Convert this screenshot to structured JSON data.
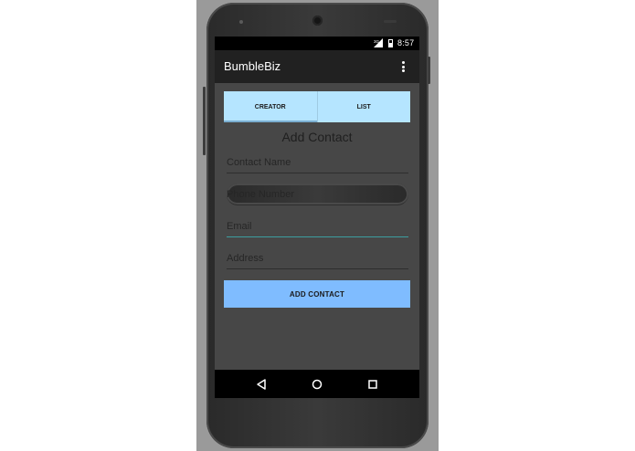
{
  "status_bar": {
    "signal_label": "3G",
    "time": "8:57"
  },
  "app_bar": {
    "title": "BumbleBiz",
    "overflow_icon": "more-vert-icon"
  },
  "tabs": [
    {
      "label": "CREATOR",
      "active": true
    },
    {
      "label": "LIST",
      "active": false
    }
  ],
  "form": {
    "title": "Add Contact",
    "fields": {
      "name": {
        "placeholder": "Contact Name",
        "value": ""
      },
      "phone": {
        "placeholder": "Phone Number",
        "value": ""
      },
      "email": {
        "placeholder": "Email",
        "value": ""
      },
      "address": {
        "placeholder": "Address",
        "value": ""
      }
    },
    "submit_label": "ADD CONTACT"
  },
  "nav_bar": {
    "back_icon": "back-triangle-icon",
    "home_icon": "home-circle-icon",
    "recent_icon": "recents-square-icon"
  },
  "colors": {
    "tab_bg": "#b5e5ff",
    "button_bg": "#7fbcff",
    "app_bar": "#212121",
    "screen_bg": "#474747",
    "focus_accent": "#3c9ea0"
  }
}
